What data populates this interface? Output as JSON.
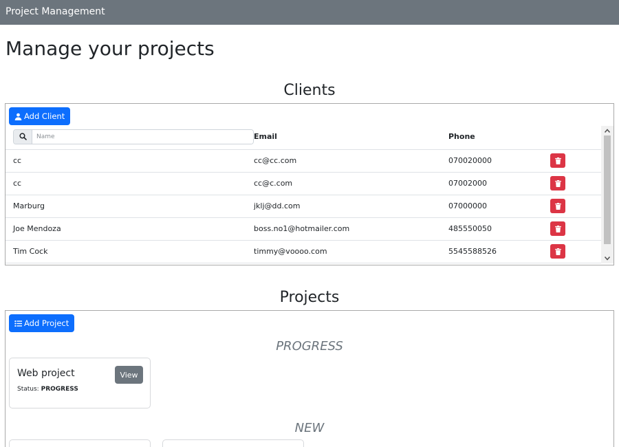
{
  "navbar": {
    "brand": "Project Management"
  },
  "page": {
    "title": "Manage your projects"
  },
  "clients": {
    "section_title": "Clients",
    "add_button_label": "Add Client",
    "search_placeholder": "Name",
    "columns": [
      "Email",
      "Phone"
    ],
    "rows": [
      {
        "name": "cc",
        "email": "cc@cc.com",
        "phone": "070020000"
      },
      {
        "name": "cc",
        "email": "cc@c.com",
        "phone": "07002000"
      },
      {
        "name": "Marburg",
        "email": "jklj@dd.com",
        "phone": "07000000"
      },
      {
        "name": "Joe Mendoza",
        "email": "boss.no1@hotmailer.com",
        "phone": "485550050"
      },
      {
        "name": "Tim Cock",
        "email": "timmy@voooo.com",
        "phone": "5545588526"
      }
    ]
  },
  "projects": {
    "section_title": "Projects",
    "add_button_label": "Add Project",
    "groups": [
      {
        "heading": "PROGRESS",
        "cards": [
          {
            "name": "Web project",
            "status_label": "Status:",
            "status": "PROGRESS",
            "view_label": "View"
          }
        ]
      },
      {
        "heading": "NEW",
        "cards": []
      }
    ]
  },
  "icons": {
    "add_client": "user-icon",
    "add_project": "list-icon",
    "search": "search-icon",
    "delete": "trash-icon"
  },
  "colors": {
    "navbar": "#6c757d",
    "primary": "#0d6efd",
    "danger": "#dc3545",
    "secondary": "#6c757d"
  }
}
